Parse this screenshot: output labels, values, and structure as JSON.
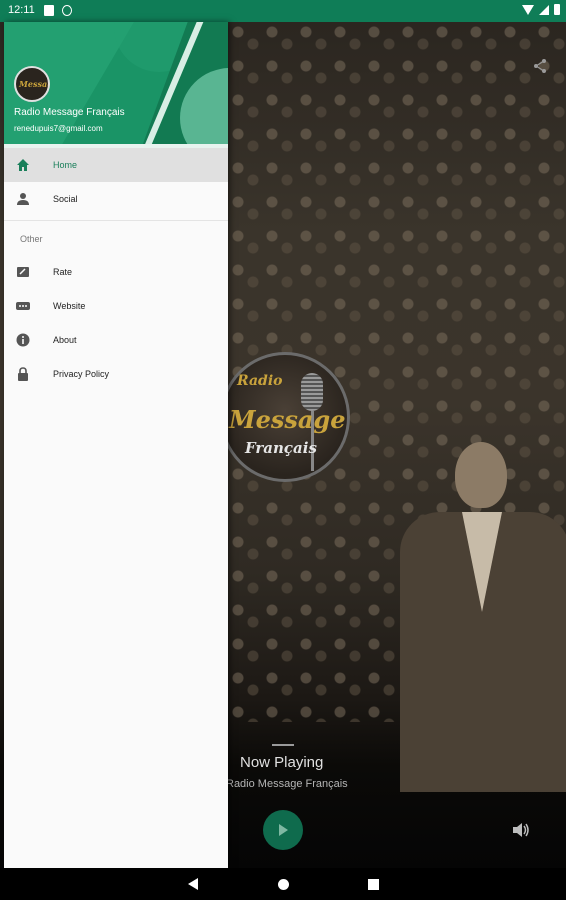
{
  "status_bar": {
    "time": "12:11"
  },
  "player": {
    "logo_line1": "Radio",
    "logo_line2": "Message",
    "logo_line3": "Français",
    "now_playing": "Now Playing",
    "station_name": "Radio Message Français"
  },
  "drawer": {
    "title": "Radio Message Français",
    "email": "renedupuis7@gmail.com",
    "items": [
      {
        "label": "Home",
        "icon": "home-icon",
        "active": true
      },
      {
        "label": "Social",
        "icon": "person-icon",
        "active": false
      }
    ],
    "section_label": "Other",
    "other_items": [
      {
        "label": "Rate",
        "icon": "rate-icon"
      },
      {
        "label": "Website",
        "icon": "website-icon"
      },
      {
        "label": "About",
        "icon": "info-icon"
      },
      {
        "label": "Privacy Policy",
        "icon": "lock-icon"
      }
    ]
  },
  "colors": {
    "accent": "#1a9466",
    "status_bar": "#0f7d57",
    "play_button": "#0f6b4d"
  }
}
